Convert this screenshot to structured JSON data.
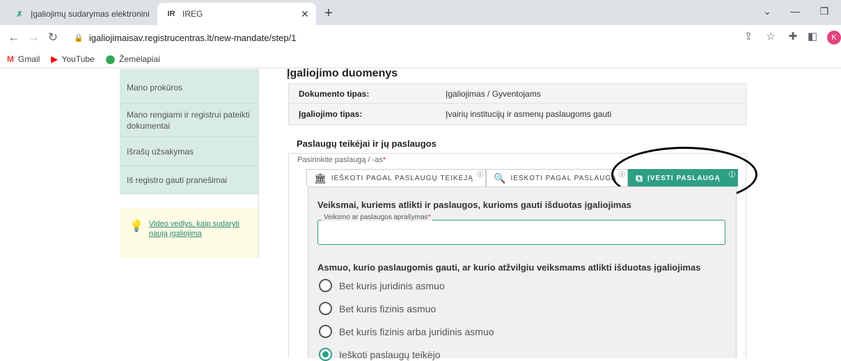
{
  "browser": {
    "tabs": [
      {
        "title": "Įgaliojimų sudarymas elektronini",
        "favicon": "registrucentras-icon",
        "active": false
      },
      {
        "title": "IREG",
        "favicon": "ireg-logo-icon",
        "favicon_text": "IR",
        "active": true
      }
    ],
    "url": "igaliojimaisav.registrucentras.lt/new-mandate/step/1",
    "avatar_letter": "K",
    "bookmarks": [
      {
        "label": "Gmail",
        "icon": "gmail-icon"
      },
      {
        "label": "YouTube",
        "icon": "youtube-icon"
      },
      {
        "label": "Žemėlapiai",
        "icon": "maps-icon"
      }
    ]
  },
  "sidebar": {
    "items": [
      {
        "label": "Mano prokūros"
      },
      {
        "label": "Mano rengiami ir registrui pateikti dokumentai"
      },
      {
        "label": "Išrašų užsakymas"
      },
      {
        "label": "Iš registro gauti pranešimai"
      }
    ],
    "video_link": "Video vedlys, kaip sudaryti naują įgaliojimą"
  },
  "main": {
    "section_title": "Įgaliojimo duomenys",
    "info_rows": [
      {
        "key": "Dokumento tipas:",
        "value": "Įgaliojimas / Gyventojams"
      },
      {
        "key": "Įgaliojimo tipas:",
        "value": "Įvairių institucijų ir asmenų paslaugoms gauti"
      }
    ],
    "services_title": "Paslaugų teikėjai ir jų paslaugos",
    "select_label": "Pasirinkite paslaugą / -as",
    "required_mark": "*",
    "tabs": [
      {
        "label": "IEŠKOTI PAGAL PASLAUGŲ TEIKĖJĄ",
        "icon": "bank-icon",
        "selected": false
      },
      {
        "label": "IEŠKOTI PAGAL PASLAUGĄ",
        "icon": "search-icon",
        "selected": false
      },
      {
        "label": "ĮVESTI PASLAUGĄ",
        "icon": "edit-square-icon",
        "selected": true
      }
    ],
    "info_glyph": "ⓘ",
    "panel_title": "Veiksmai, kuriems atlikti ir paslaugos, kurioms gauti išduotas įgaliojimas",
    "field_legend": "Veiksmo ar paslaugos aprašymas",
    "field_value": "",
    "radio_title": "Asmuo, kurio paslaugomis gauti, ar kurio atžvilgiu veiksmams atlikti išduotas įgaliojimas",
    "radios": [
      {
        "label": "Bet kuris juridinis asmuo",
        "checked": false
      },
      {
        "label": "Bet kuris fizinis asmuo",
        "checked": false
      },
      {
        "label": "Bet kuris fizinis arba juridinis asmuo",
        "checked": false
      },
      {
        "label": "Ieškoti paslaugų teikėjo",
        "checked": true
      }
    ]
  },
  "colors": {
    "accent": "#2e9e84",
    "sidebar_bg": "#d8ebe6",
    "video_bg": "#fdfbe4"
  }
}
